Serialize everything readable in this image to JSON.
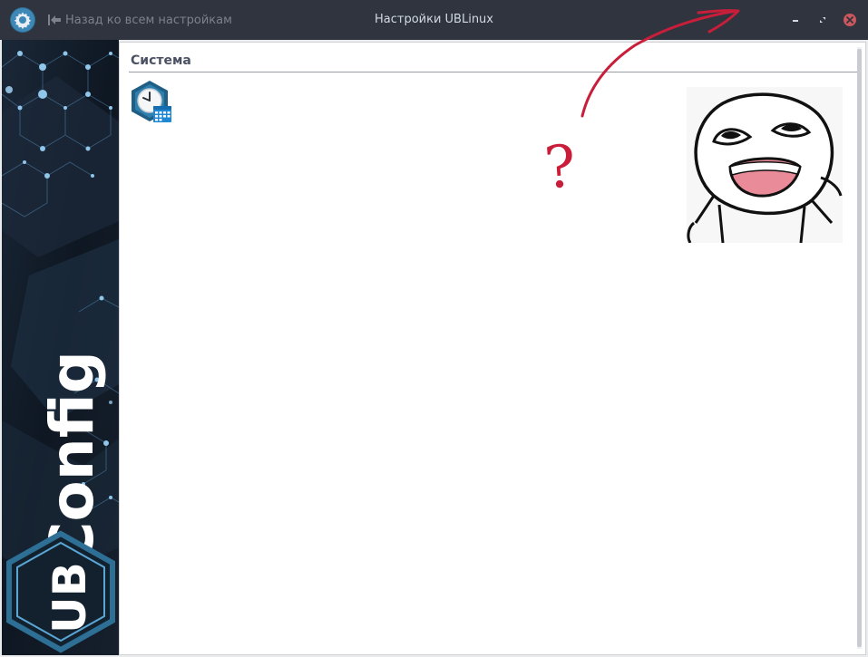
{
  "window": {
    "title": "Настройки UBLinux",
    "back_label": "Назад ко всем настройкам"
  },
  "sidebar": {
    "brand": "UBConfig"
  },
  "main": {
    "section_title": "Система",
    "tiles": [
      {
        "icon": "date-time-icon"
      }
    ]
  },
  "annotation": {
    "mark": "?"
  },
  "colors": {
    "titlebar": "#2f343f",
    "accent": "#2e6f96",
    "close": "#cc575d",
    "annotation": "#c81e3a"
  }
}
